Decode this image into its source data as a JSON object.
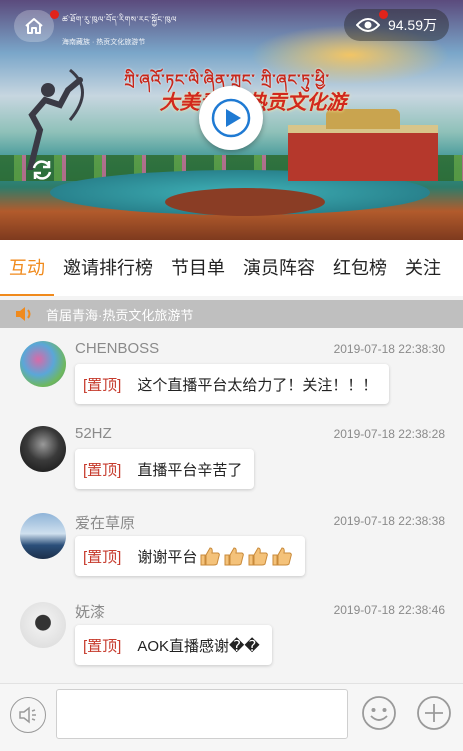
{
  "header": {
    "logo_line1": "ཚ་ཐོག་རུ་ཁུལ་བོད་རིགས་རང་སྐྱོང་ཁུལ",
    "logo_line2": "海南藏族 · 热贡文化旅游节",
    "viewer_count": "94.59万",
    "banner_tibetan": "ཀྲི་ཞའོ་ཏང་ལི་ཞིན་ཀྲུང་ ཀྲི་ཞང་ཏུ་ཕྱི་",
    "banner_chinese": "大美青海·热贡文化游"
  },
  "tabs": [
    {
      "label": "互动",
      "active": true
    },
    {
      "label": "邀请排行榜",
      "active": false
    },
    {
      "label": "节目单",
      "active": false
    },
    {
      "label": "演员阵容",
      "active": false
    },
    {
      "label": "红包榜",
      "active": false
    },
    {
      "label": "关注",
      "active": false
    }
  ],
  "notice": {
    "text": "首届青海·热贡文化旅游节"
  },
  "messages": [
    {
      "username": "CHENBOSS",
      "time": "2019-07-18 22:38:30",
      "pin": "[置顶]",
      "text": "这个直播平台太给力了！关注！！！"
    },
    {
      "username": "52HZ",
      "time": "2019-07-18 22:38:28",
      "pin": "[置顶]",
      "text": "直播平台辛苦了"
    },
    {
      "username": "爱在草原",
      "time": "2019-07-18 22:38:38",
      "pin": "[置顶]",
      "text": "谢谢平台"
    },
    {
      "username": "妩漆",
      "time": "2019-07-18 22:38:46",
      "pin": "[置顶]",
      "text": "AOK直播感谢��"
    }
  ],
  "bottom_bar": {
    "input_placeholder": ""
  },
  "colors": {
    "accent": "#f08a1c",
    "pin": "#c63a2c",
    "notice_bg": "#bfbfbf",
    "badge": "#e0231b"
  },
  "icons": [
    "home-icon",
    "eye-icon",
    "play-icon",
    "refresh-icon",
    "speaker-icon",
    "voice-icon",
    "emoji-icon",
    "plus-icon",
    "thumbs-up-icon"
  ]
}
